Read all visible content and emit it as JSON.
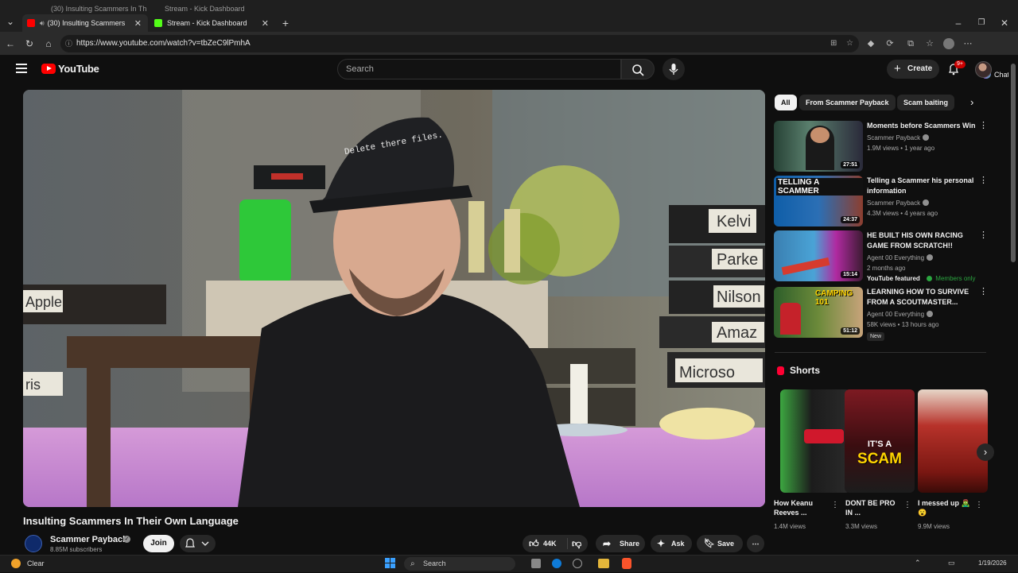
{
  "browser": {
    "ghost_tabs": [
      "(30) Insulting Scammers In Th",
      "Stream - Kick Dashboard"
    ],
    "tabs": [
      {
        "label": "(30) Insulting Scammers In Th",
        "active": true,
        "favicon_color": "#ff0000"
      },
      {
        "label": "Stream - Kick Dashboard",
        "active": false,
        "favicon_color": "#53fc18"
      }
    ],
    "url": "https://www.youtube.com/watch?v=tbZeC9lPmhA",
    "chat_label": "Chat"
  },
  "header": {
    "logo_text": "YouTube",
    "search_placeholder": "Search",
    "create_label": "Create",
    "notification_count": "9+"
  },
  "video": {
    "title": "Insulting Scammers In Their Own Language",
    "channel": "Scammer Payback",
    "subscribers": "8.85M subscribers",
    "join_label": "Join",
    "like_count": "44K",
    "share_label": "Share",
    "ask_label": "Ask",
    "save_label": "Save",
    "cap_text": "Delete there files.",
    "binder_labels": [
      "Kelvi",
      "Parke",
      "Nilson",
      "Amaz",
      "Microso",
      "Apple",
      "ris"
    ]
  },
  "sidebar": {
    "chips": [
      "All",
      "From Scammer Payback",
      "Scam baiting"
    ],
    "recommendations": [
      {
        "title": "Moments before Scammers Win",
        "channel": "Scammer Payback",
        "meta": "1.9M views • 1 year ago",
        "duration": "27:51",
        "extra": ""
      },
      {
        "title": "Telling a Scammer his personal information",
        "channel": "Scammer Payback",
        "meta": "4.3M views • 4 years ago",
        "duration": "24:37",
        "extra": "",
        "thumb_text": "TELLING A SCAMMER"
      },
      {
        "title": "HE BUILT HIS OWN RACING GAME FROM SCRATCH!!",
        "channel": "Agent 00 Everything",
        "meta": "2 months ago",
        "duration": "15:14",
        "featured": "YouTube featured",
        "members": "Members only"
      },
      {
        "title": "LEARNING HOW TO SURVIVE FROM A SCOUTMASTER...",
        "channel": "Agent 00 Everything",
        "meta": "58K views • 13 hours ago",
        "duration": "51:12",
        "badge": "New",
        "thumb_text": "CAMPING 101"
      }
    ],
    "shorts_heading": "Shorts",
    "shorts": [
      {
        "title": "How Keanu Reeves ...",
        "views": "1.4M views"
      },
      {
        "title": "DONT BE PRO IN ...",
        "views": "3.3M views",
        "overlay_top": "IT'S A",
        "overlay_bottom": "SCAM"
      },
      {
        "title": "I messed up 🧟‍♂️😮",
        "views": "9.9M views"
      }
    ]
  },
  "taskbar": {
    "weather": "Clear",
    "search_label": "Search",
    "date": "1/19/2026"
  },
  "colors": {
    "background": "#0f0f0f",
    "accent_red": "#ff0000",
    "members_green": "#2ba640"
  }
}
